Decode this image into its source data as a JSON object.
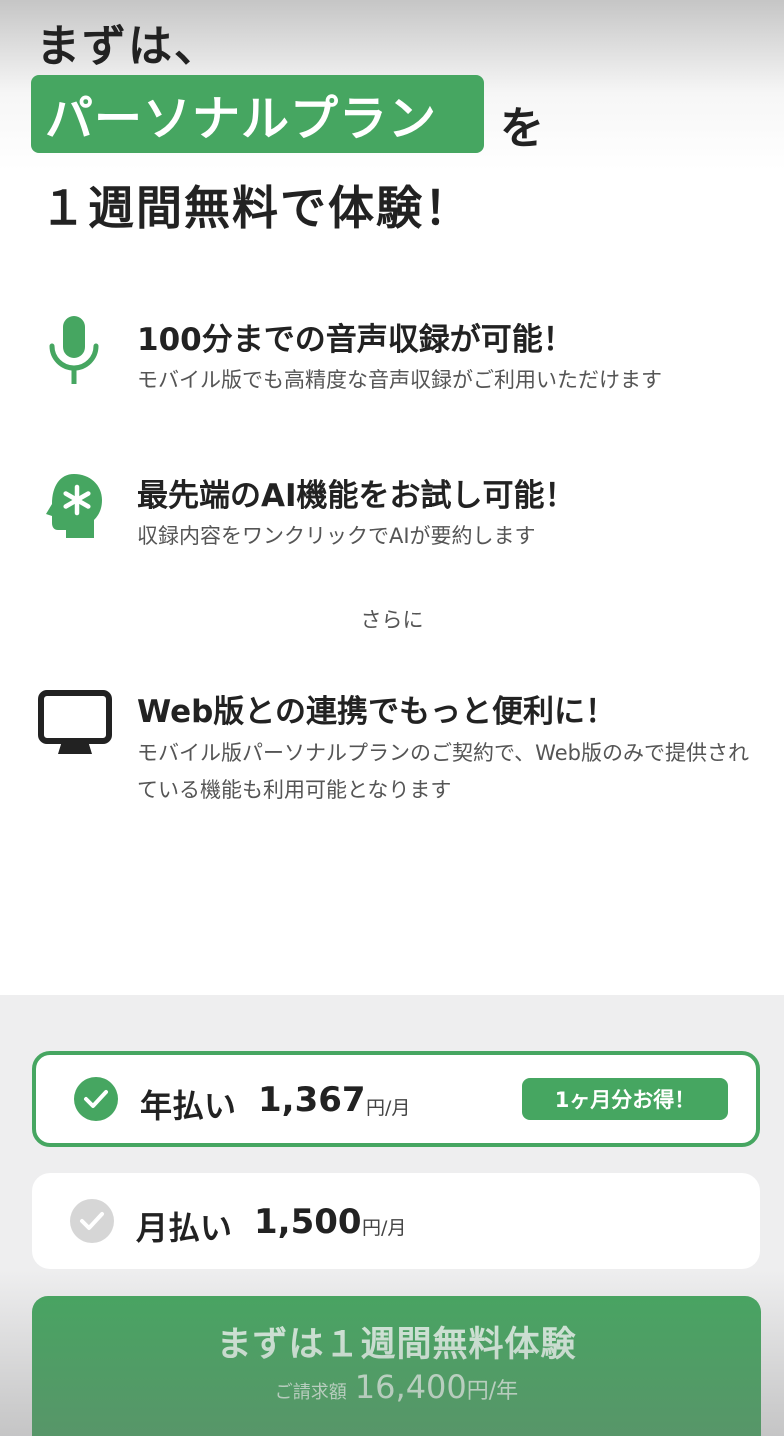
{
  "headline": {
    "line1": "まずは、",
    "plan_badge": "パーソナルプラン",
    "particle": "を",
    "line3": "１週間無料で体験！"
  },
  "features": [
    {
      "icon": "microphone-icon",
      "title": "100分までの音声収録が可能！",
      "desc": "モバイル版でも高精度な音声収録がご利用いただけます"
    },
    {
      "icon": "ai-head-icon",
      "title": "最先端のAI機能をお試し可能！",
      "desc": "収録内容をワンクリックでAIが要約します"
    },
    {
      "icon": "monitor-icon",
      "title": "Web版との連携でもっと便利に！",
      "desc": "モバイル版パーソナルプランのご契約で、Web版のみで提供されている機能も利用可能となります"
    }
  ],
  "connector": "さらに",
  "plans": {
    "annual": {
      "name": "年払い",
      "price": "1,367",
      "unit": "円/月",
      "badge": "1ヶ月分お得！",
      "selected": true
    },
    "monthly": {
      "name": "月払い",
      "price": "1,500",
      "unit": "円/月",
      "selected": false
    }
  },
  "cta": {
    "title": "まずは１週間無料体験",
    "billing_label": "ご請求額",
    "billing_amount": "16,400",
    "billing_unit": "円/年"
  },
  "colors": {
    "accent": "#46a661",
    "check_inactive": "#d6d6d6"
  }
}
